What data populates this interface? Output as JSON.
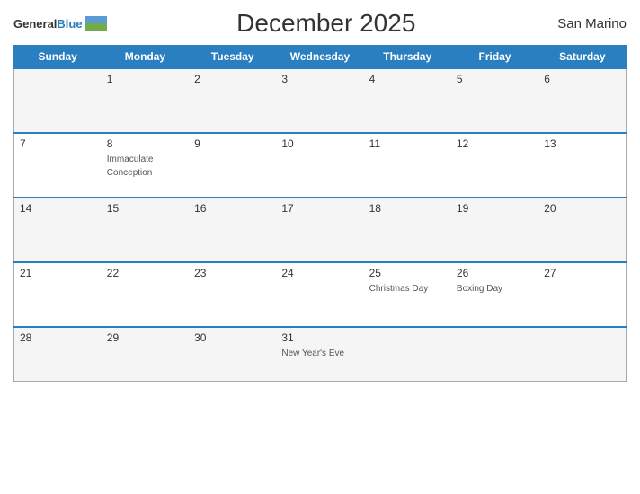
{
  "header": {
    "logo_general": "General",
    "logo_blue": "Blue",
    "title": "December 2025",
    "country": "San Marino"
  },
  "days_of_week": [
    "Sunday",
    "Monday",
    "Tuesday",
    "Wednesday",
    "Thursday",
    "Friday",
    "Saturday"
  ],
  "weeks": [
    [
      {
        "num": "",
        "holiday": ""
      },
      {
        "num": "1",
        "holiday": ""
      },
      {
        "num": "2",
        "holiday": ""
      },
      {
        "num": "3",
        "holiday": ""
      },
      {
        "num": "4",
        "holiday": ""
      },
      {
        "num": "5",
        "holiday": ""
      },
      {
        "num": "6",
        "holiday": ""
      }
    ],
    [
      {
        "num": "7",
        "holiday": ""
      },
      {
        "num": "8",
        "holiday": "Immaculate Conception"
      },
      {
        "num": "9",
        "holiday": ""
      },
      {
        "num": "10",
        "holiday": ""
      },
      {
        "num": "11",
        "holiday": ""
      },
      {
        "num": "12",
        "holiday": ""
      },
      {
        "num": "13",
        "holiday": ""
      }
    ],
    [
      {
        "num": "14",
        "holiday": ""
      },
      {
        "num": "15",
        "holiday": ""
      },
      {
        "num": "16",
        "holiday": ""
      },
      {
        "num": "17",
        "holiday": ""
      },
      {
        "num": "18",
        "holiday": ""
      },
      {
        "num": "19",
        "holiday": ""
      },
      {
        "num": "20",
        "holiday": ""
      }
    ],
    [
      {
        "num": "21",
        "holiday": ""
      },
      {
        "num": "22",
        "holiday": ""
      },
      {
        "num": "23",
        "holiday": ""
      },
      {
        "num": "24",
        "holiday": ""
      },
      {
        "num": "25",
        "holiday": "Christmas Day"
      },
      {
        "num": "26",
        "holiday": "Boxing Day"
      },
      {
        "num": "27",
        "holiday": ""
      }
    ],
    [
      {
        "num": "28",
        "holiday": ""
      },
      {
        "num": "29",
        "holiday": ""
      },
      {
        "num": "30",
        "holiday": ""
      },
      {
        "num": "31",
        "holiday": "New Year's Eve"
      },
      {
        "num": "",
        "holiday": ""
      },
      {
        "num": "",
        "holiday": ""
      },
      {
        "num": "",
        "holiday": ""
      }
    ]
  ]
}
